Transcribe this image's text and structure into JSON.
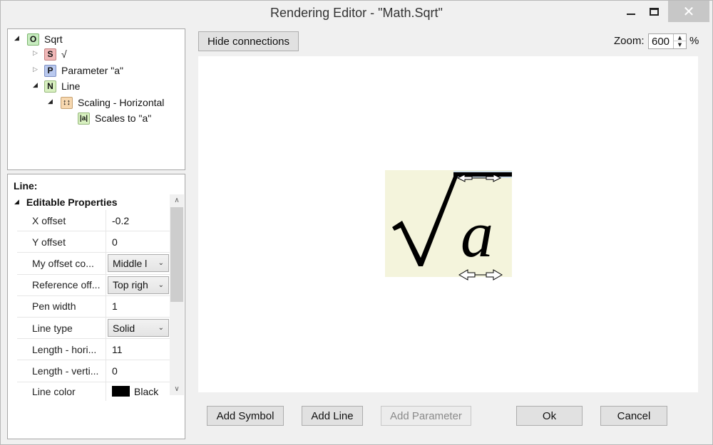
{
  "window": {
    "title": "Rendering Editor - \"Math.Sqrt\"",
    "minimize_icon": "minimize-icon",
    "maximize_icon": "maximize-icon",
    "close_icon": "close-icon",
    "close_glyph": "✕"
  },
  "tree": {
    "nodes": [
      {
        "badge": "O",
        "label": "Sqrt",
        "expanded": true
      },
      {
        "badge": "S",
        "label": "√",
        "expanded": false
      },
      {
        "badge": "P",
        "label": "Parameter \"a\"",
        "expanded": false
      },
      {
        "badge": "N",
        "label": "Line",
        "expanded": true
      },
      {
        "badge": "scaling-icon",
        "label": "Scaling - Horizontal",
        "expanded": true,
        "selected": true
      },
      {
        "badge": "scales-to-icon",
        "label": "Scales to \"a\""
      }
    ],
    "scaling_glyph": "↕↕",
    "scales_glyph": "|a|"
  },
  "properties": {
    "title": "Line:",
    "category": "Editable Properties",
    "rows": [
      {
        "name": "X offset",
        "value": "-0.2"
      },
      {
        "name": "Y offset",
        "value": "0"
      },
      {
        "name": "My offset co...",
        "value": "Middle l",
        "combo": true
      },
      {
        "name": "Reference off...",
        "value": "Top righ",
        "combo": true
      },
      {
        "name": "Pen width",
        "value": "1"
      },
      {
        "name": "Line type",
        "value": "Solid",
        "combo": true
      },
      {
        "name": "Length - hori...",
        "value": "11"
      },
      {
        "name": "Length - verti...",
        "value": "0"
      },
      {
        "name": "Line color",
        "value": "Black",
        "color": "#000000"
      }
    ]
  },
  "toolbar": {
    "hide_connections": "Hide connections",
    "zoom_label": "Zoom:",
    "zoom_value": "600",
    "zoom_unit": "%"
  },
  "canvas": {
    "symbol": "√",
    "parameter": "a",
    "background": "#f4f4dc"
  },
  "buttons": {
    "add_symbol": "Add Symbol",
    "add_line": "Add Line",
    "add_parameter": "Add Parameter",
    "ok": "Ok",
    "cancel": "Cancel"
  }
}
